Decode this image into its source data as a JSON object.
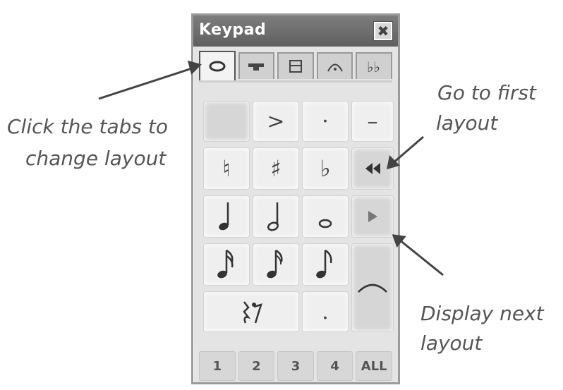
{
  "window": {
    "title": "Keypad",
    "close_label": "✖"
  },
  "tabs": [
    {
      "id": "common",
      "icon": "whole-note-icon",
      "active": true
    },
    {
      "id": "more-notes",
      "icon": "accent-icon"
    },
    {
      "id": "beams",
      "icon": "beam-icon"
    },
    {
      "id": "articulations",
      "icon": "fermata-icon"
    },
    {
      "id": "accidentals",
      "icon": "double-flat-icon"
    }
  ],
  "keys": {
    "accent": ">",
    "staccato": "·",
    "tenuto": "–",
    "natural": "♮",
    "sharp": "♯",
    "flat": "♭",
    "dot": "."
  },
  "number_buttons": [
    "1",
    "2",
    "3",
    "4",
    "ALL"
  ],
  "annotations": {
    "tabs_line1": "Click the tabs to",
    "tabs_line2": "change layout",
    "first_line1": "Go to first",
    "first_line2": "layout",
    "next_line1": "Display next",
    "next_line2": "layout"
  }
}
